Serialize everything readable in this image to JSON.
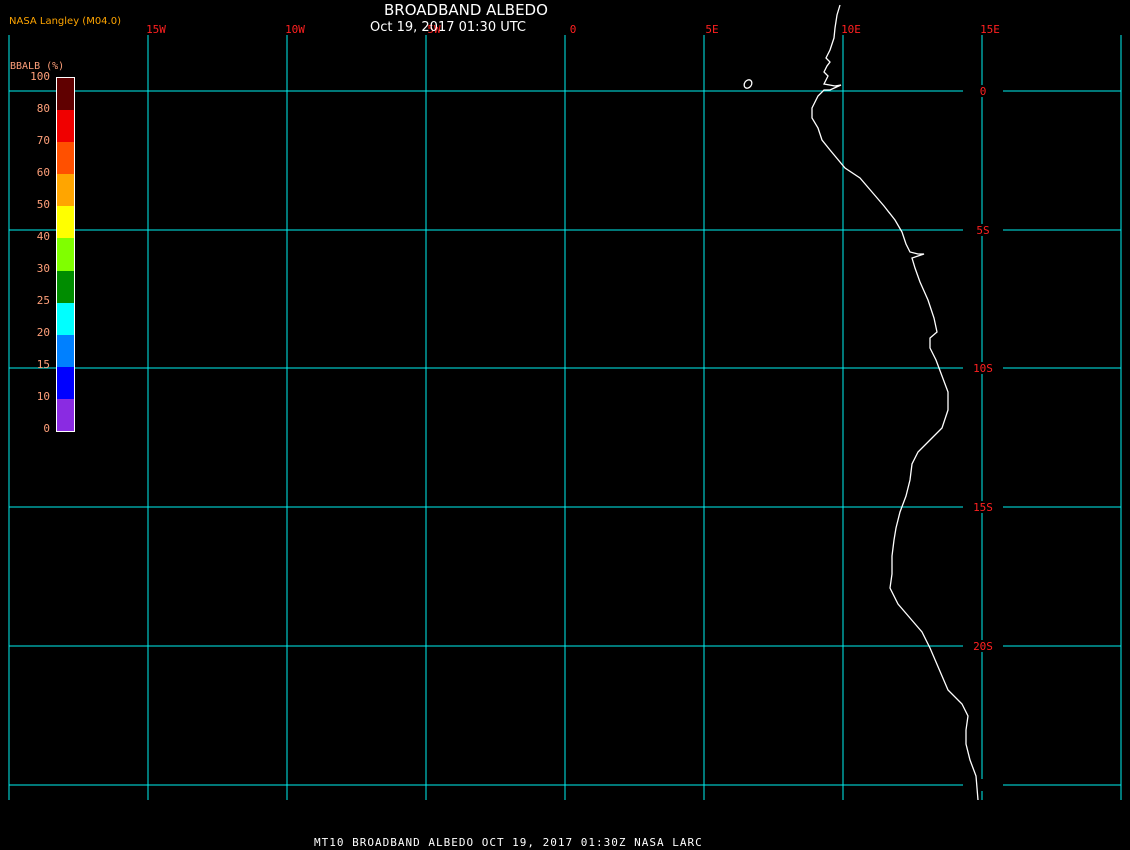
{
  "header": {
    "title": "BROADBAND ALBEDO",
    "subtitle": "Oct 19, 2017 01:30 UTC",
    "credit": "NASA Langley (M04.0)"
  },
  "map": {
    "grid_color": "#00f0f0",
    "label_color": "#ff2020",
    "coastline_color": "#ffffff",
    "longitude_labels": [
      "15W",
      "10W",
      "5W",
      "0",
      "5E",
      "10E",
      "15E"
    ],
    "latitude_labels": [
      "0",
      "5S",
      "10S",
      "15S",
      "20S"
    ]
  },
  "colorbar": {
    "title": "BBALB (%)",
    "labels": [
      "100",
      "80",
      "70",
      "60",
      "50",
      "40",
      "30",
      "25",
      "20",
      "15",
      "10",
      "0"
    ],
    "colors": [
      "#600000",
      "#f00000",
      "#ff5000",
      "#ffa500",
      "#ffff00",
      "#80ff00",
      "#008c00",
      "#00ffff",
      "#0080ff",
      "#0000ff",
      "#8a2be2"
    ]
  },
  "footer": {
    "text": "MT10  BROADBAND ALBEDO   OCT 19, 2017 01:30Z   NASA LARC"
  }
}
